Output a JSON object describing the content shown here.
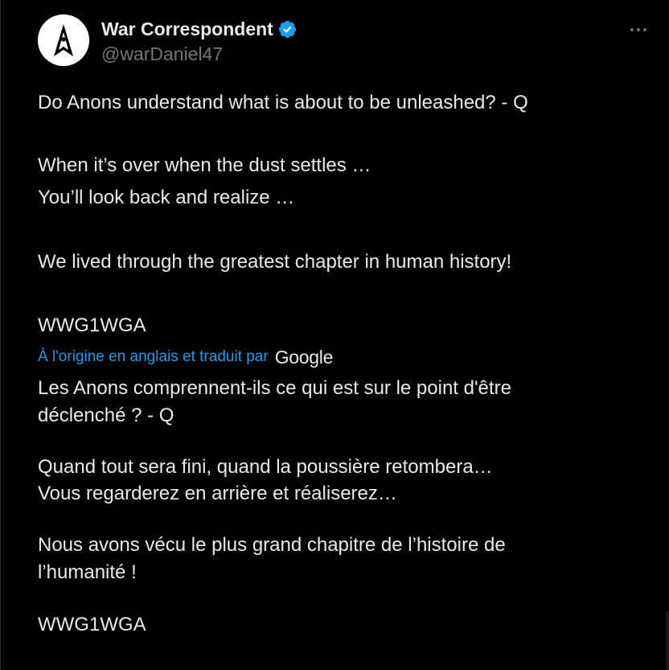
{
  "author": {
    "display_name": "War Correspondent",
    "handle": "@warDaniel47",
    "verified": true
  },
  "menu": {
    "more_icon": "more-horizontal-icon"
  },
  "original_text": [
    "Do Anons understand what is about to be unleashed? - Q",
    "When it’s over when the dust settles …",
    "You’ll look back and realize …",
    "We lived through the greatest chapter in human history!",
    "WWG1WGA"
  ],
  "translation": {
    "label": "À l'origine en anglais et traduit par",
    "provider": "Google",
    "text": [
      "Les Anons comprennent-ils ce qui est sur le point d'être",
      "déclenché ? - Q",
      "Quand tout sera fini, quand la poussière retombera…",
      "Vous regarderez en arrière et réaliserez…",
      "Nous avons vécu le plus grand chapitre de l’histoire de",
      "l’humanité !",
      "WWG1WGA"
    ]
  },
  "colors": {
    "background": "#000000",
    "text": "#e7e9ea",
    "muted": "#71767b",
    "accent": "#1d9bf0"
  }
}
